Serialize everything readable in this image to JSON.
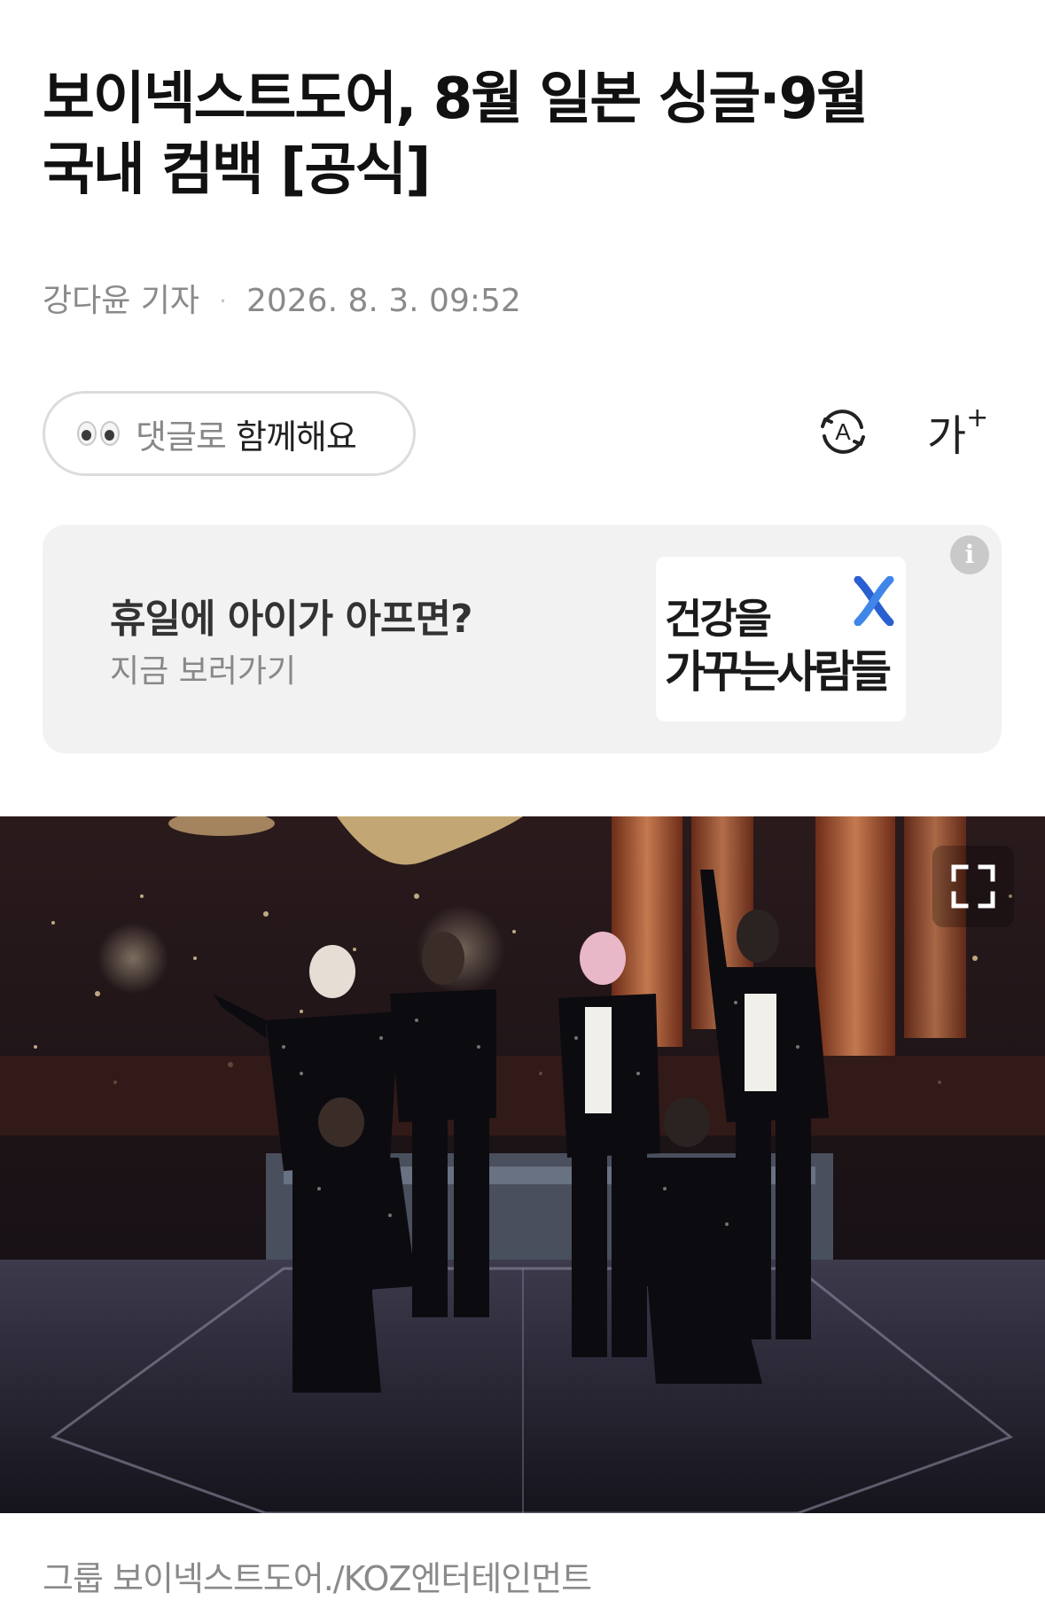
{
  "article": {
    "headline_line1": "보이넥스트도어, 8월 일본 싱글·9월",
    "headline_line2": "국내 컴백 [공식]",
    "reporter": "강다윤 기자",
    "byline_separator": "·",
    "timestamp": "2026. 8. 3. 09:52"
  },
  "toolbar": {
    "comment_prefix": "댓글로",
    "comment_suffix": "함께해요",
    "translate_icon": "translate-a-icon",
    "fontsize_label": "가",
    "fontsize_plus": "+"
  },
  "ad": {
    "title": "휴일에 아이가 아프면?",
    "subtitle": "지금 보러가기",
    "logo_line1": "건강을",
    "logo_line2": "가꾸는사람들",
    "info_label": "i"
  },
  "photo": {
    "description_icon": "photo",
    "expand_icon": "expand-icon"
  },
  "caption": {
    "text": "그룹 보이넥스트도어./KOZ엔터테인먼트"
  },
  "colors": {
    "text_primary": "#111111",
    "text_muted": "#8a8a8a",
    "ad_background": "#f2f2f2",
    "logo_blue": "#2a5fd1"
  }
}
